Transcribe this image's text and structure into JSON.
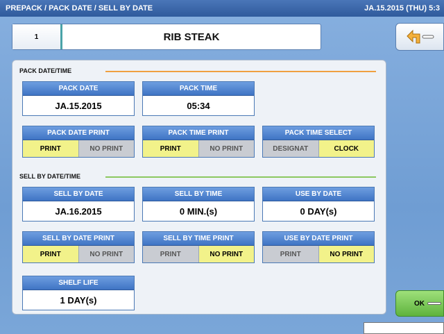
{
  "titlebar": {
    "breadcrumb": "PREPACK / PACK DATE / SELL BY DATE",
    "datetime": "JA.15.2015 (THU)  5:3"
  },
  "item": {
    "number": "1",
    "name": "RIB STEAK"
  },
  "back_button": {
    "icon": "back-arrow-icon"
  },
  "pack_section": {
    "label": "PACK DATE/TIME",
    "line_color": "#f0a040",
    "pack_date": {
      "label": "PACK DATE",
      "value": "JA.15.2015"
    },
    "pack_time": {
      "label": "PACK TIME",
      "value": "05:34"
    },
    "pack_date_print": {
      "label": "PACK DATE PRINT",
      "options": [
        "PRINT",
        "NO PRINT"
      ],
      "selected": "PRINT"
    },
    "pack_time_print": {
      "label": "PACK TIME PRINT",
      "options": [
        "PRINT",
        "NO PRINT"
      ],
      "selected": "PRINT"
    },
    "pack_time_select": {
      "label": "PACK TIME SELECT",
      "options": [
        "DESIGNAT",
        "CLOCK"
      ],
      "selected": "CLOCK"
    }
  },
  "sell_section": {
    "label": "SELL BY DATE/TIME",
    "line_color": "#8cc860",
    "sell_by_date": {
      "label": "SELL BY DATE",
      "value": "JA.16.2015"
    },
    "sell_by_time": {
      "label": "SELL BY TIME",
      "value": "0 MIN.(s)"
    },
    "use_by_date": {
      "label": "USE BY DATE",
      "value": "0 DAY(s)"
    },
    "sell_by_date_print": {
      "label": "SELL BY DATE PRINT",
      "options": [
        "PRINT",
        "NO PRINT"
      ],
      "selected": "PRINT"
    },
    "sell_by_time_print": {
      "label": "SELL BY TIME PRINT",
      "options": [
        "PRINT",
        "NO PRINT"
      ],
      "selected": "NO PRINT"
    },
    "use_by_date_print": {
      "label": "USE BY DATE PRINT",
      "options": [
        "PRINT",
        "NO PRINT"
      ],
      "selected": "NO PRINT"
    },
    "shelf_life": {
      "label": "SHELF LIFE",
      "value": "1 DAY(s)"
    }
  },
  "ok_button": {
    "label": "OK"
  },
  "colors": {
    "selected_option": "#f2f28a",
    "unselected_option": "#c9ccd2",
    "header_blue": "#3f74c4",
    "ok_green": "#5fb33e"
  }
}
